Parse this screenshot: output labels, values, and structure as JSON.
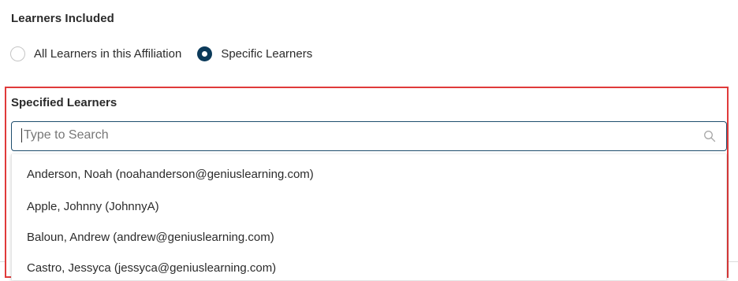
{
  "learners_included": {
    "title": "Learners Included",
    "options": [
      {
        "label": "All Learners in this Affiliation",
        "checked": false
      },
      {
        "label": "Specific Learners",
        "checked": true
      }
    ]
  },
  "specified_learners": {
    "title": "Specified Learners",
    "search": {
      "placeholder": "Type to Search",
      "value": ""
    },
    "results": [
      "Anderson, Noah (noahanderson@geniuslearning.com)",
      "Apple, Johnny (JohnnyA)",
      "Baloun, Andrew (andrew@geniuslearning.com)",
      "Castro, Jessyca (jessyca@geniuslearning.com)"
    ]
  },
  "colors": {
    "accent": "#0b3a5a",
    "highlight": "#e03a3a",
    "input_border": "#1f4e6e"
  },
  "icons": {
    "search": "search-icon"
  }
}
